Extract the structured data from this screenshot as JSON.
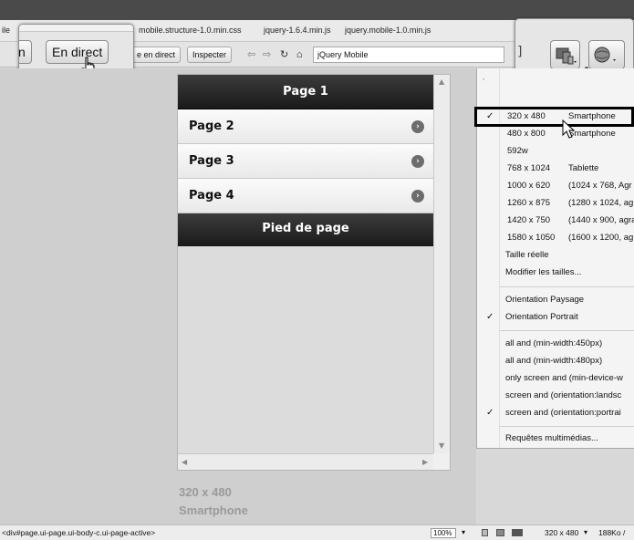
{
  "related_files": [
    "mobile.structure-1.0.min.css",
    "jquery-1.6.4.min.js",
    "jquery.mobile-1.0.min.js"
  ],
  "related_files_left_fragment": "ile",
  "toolbar": {
    "live_code_label": "e en direct",
    "inspect_label": "Inspecter",
    "address_value": "jQuery Mobile"
  },
  "zoom_left": {
    "partial_label": "n",
    "live_label": "En direct"
  },
  "jqm_page": {
    "header_title": "Page 1",
    "list_items": [
      "Page 2",
      "Page 3",
      "Page 4"
    ],
    "footer_title": "Pied de page",
    "arrow_glyph": "›"
  },
  "size_caption": {
    "dimensions": "320 x 480",
    "device": "Smartphone"
  },
  "size_menu": {
    "checkmark": "✓",
    "presets": [
      {
        "res": "320 x  480",
        "device": "Smartphone",
        "checked": true
      },
      {
        "res": "480 x  800",
        "device": "Smartphone",
        "checked": false
      },
      {
        "res": "592w",
        "device": "",
        "checked": false
      },
      {
        "res": "768 x 1024",
        "device": "Tablette",
        "checked": false
      },
      {
        "res": "1000 x  620",
        "device": "(1024 x 768, Agr",
        "checked": false
      },
      {
        "res": "1260 x  875",
        "device": "(1280 x 1024, ag",
        "checked": false
      },
      {
        "res": "1420 x  750",
        "device": "(1440 x 900, agra",
        "checked": false
      },
      {
        "res": "1580 x 1050",
        "device": "(1600 x 1200, ag",
        "checked": false
      }
    ],
    "actual_size": "Taille réelle",
    "edit_sizes": "Modifier les tailles...",
    "orientation_landscape": "Orientation Paysage",
    "orientation_portrait": "Orientation Portrait",
    "media_queries": [
      {
        "label": "all and (min-width:450px)",
        "checked": false
      },
      {
        "label": "all and (min-width:480px)",
        "checked": false
      },
      {
        "label": "only screen and (min-device-w",
        "checked": false
      },
      {
        "label": "screen and (orientation:landsc",
        "checked": false
      },
      {
        "label": "screen and (orientation:portrai",
        "checked": true
      }
    ],
    "media_queries_label": "Requêtes multimédias..."
  },
  "status_bar": {
    "tag_path": "<div#page.ui-page.ui-body-c.ui-page-active>",
    "zoom": "100%",
    "window_size": "320 x 480",
    "file_size": "188Ko /"
  },
  "icons": {
    "back": "⇦",
    "forward": "⇨",
    "refresh": "↻",
    "home": "⌂",
    "scroll_up": "▲",
    "scroll_down": "▼",
    "scroll_left": "◀",
    "scroll_right": "▶",
    "dropdown": "▾"
  }
}
